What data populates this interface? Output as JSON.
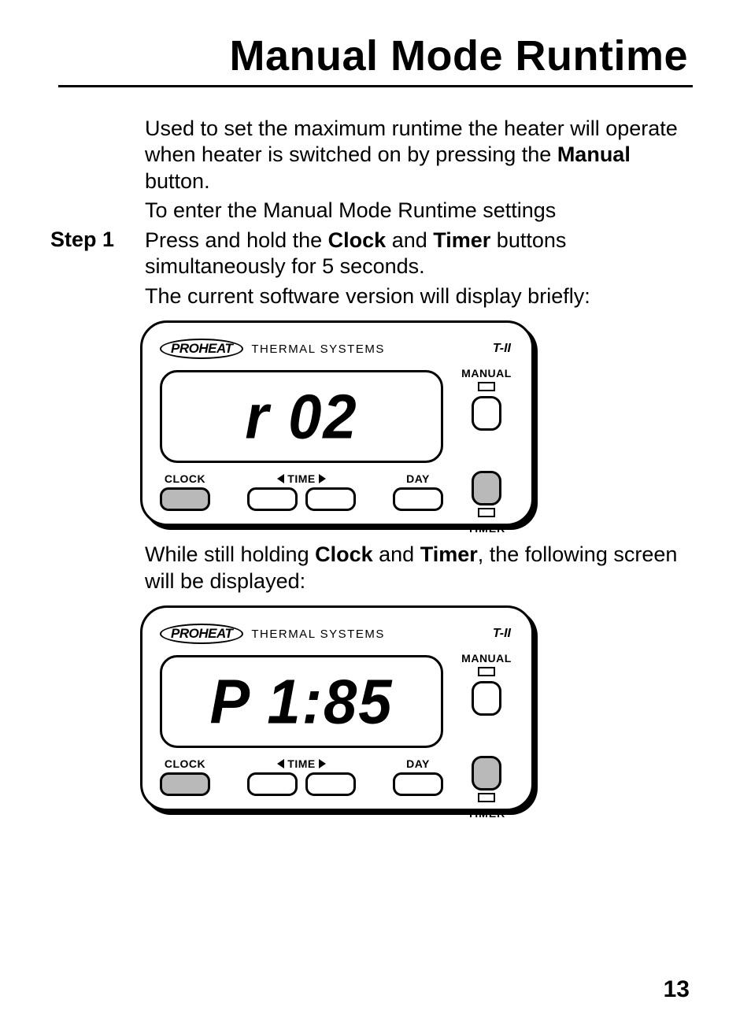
{
  "title": "Manual Mode Runtime",
  "intro": {
    "p1a": "Used to set the maximum runtime the heater will operate when heater is switched on by pressing the ",
    "p1b": "Manual",
    "p1c": " button.",
    "p2": "To enter the Manual Mode Runtime settings"
  },
  "step1": {
    "label": "Step 1",
    "s1a": "Press and hold the ",
    "s1b": "Clock",
    "s1c": " and ",
    "s1d": "Timer",
    "s1e": " buttons simultaneously for 5 seconds.",
    "s2": "The current software version will display briefly:"
  },
  "mid": {
    "m1a": "While still holding ",
    "m1b": "Clock",
    "m1c": " and ",
    "m1d": "Timer",
    "m1e": ", the following screen will be displayed:"
  },
  "device": {
    "logo": "PROHEAT",
    "thermal": "THERMAL SYSTEMS",
    "model": "T-II",
    "manual": "MANUAL",
    "clock": "CLOCK",
    "time": "TIME",
    "day": "DAY",
    "timer": "TIMER"
  },
  "lcd1": "r 02",
  "lcd2": "P 1:85",
  "page": "13"
}
